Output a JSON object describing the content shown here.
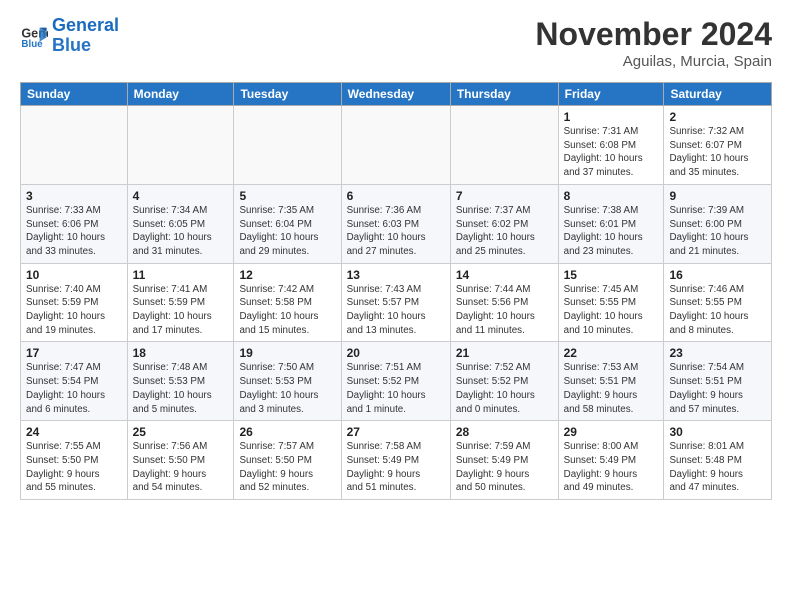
{
  "header": {
    "logo_line1": "General",
    "logo_line2": "Blue",
    "month_title": "November 2024",
    "location": "Aguilas, Murcia, Spain"
  },
  "weekdays": [
    "Sunday",
    "Monday",
    "Tuesday",
    "Wednesday",
    "Thursday",
    "Friday",
    "Saturday"
  ],
  "weeks": [
    [
      {
        "day": "",
        "info": ""
      },
      {
        "day": "",
        "info": ""
      },
      {
        "day": "",
        "info": ""
      },
      {
        "day": "",
        "info": ""
      },
      {
        "day": "",
        "info": ""
      },
      {
        "day": "1",
        "info": "Sunrise: 7:31 AM\nSunset: 6:08 PM\nDaylight: 10 hours\nand 37 minutes."
      },
      {
        "day": "2",
        "info": "Sunrise: 7:32 AM\nSunset: 6:07 PM\nDaylight: 10 hours\nand 35 minutes."
      }
    ],
    [
      {
        "day": "3",
        "info": "Sunrise: 7:33 AM\nSunset: 6:06 PM\nDaylight: 10 hours\nand 33 minutes."
      },
      {
        "day": "4",
        "info": "Sunrise: 7:34 AM\nSunset: 6:05 PM\nDaylight: 10 hours\nand 31 minutes."
      },
      {
        "day": "5",
        "info": "Sunrise: 7:35 AM\nSunset: 6:04 PM\nDaylight: 10 hours\nand 29 minutes."
      },
      {
        "day": "6",
        "info": "Sunrise: 7:36 AM\nSunset: 6:03 PM\nDaylight: 10 hours\nand 27 minutes."
      },
      {
        "day": "7",
        "info": "Sunrise: 7:37 AM\nSunset: 6:02 PM\nDaylight: 10 hours\nand 25 minutes."
      },
      {
        "day": "8",
        "info": "Sunrise: 7:38 AM\nSunset: 6:01 PM\nDaylight: 10 hours\nand 23 minutes."
      },
      {
        "day": "9",
        "info": "Sunrise: 7:39 AM\nSunset: 6:00 PM\nDaylight: 10 hours\nand 21 minutes."
      }
    ],
    [
      {
        "day": "10",
        "info": "Sunrise: 7:40 AM\nSunset: 5:59 PM\nDaylight: 10 hours\nand 19 minutes."
      },
      {
        "day": "11",
        "info": "Sunrise: 7:41 AM\nSunset: 5:59 PM\nDaylight: 10 hours\nand 17 minutes."
      },
      {
        "day": "12",
        "info": "Sunrise: 7:42 AM\nSunset: 5:58 PM\nDaylight: 10 hours\nand 15 minutes."
      },
      {
        "day": "13",
        "info": "Sunrise: 7:43 AM\nSunset: 5:57 PM\nDaylight: 10 hours\nand 13 minutes."
      },
      {
        "day": "14",
        "info": "Sunrise: 7:44 AM\nSunset: 5:56 PM\nDaylight: 10 hours\nand 11 minutes."
      },
      {
        "day": "15",
        "info": "Sunrise: 7:45 AM\nSunset: 5:55 PM\nDaylight: 10 hours\nand 10 minutes."
      },
      {
        "day": "16",
        "info": "Sunrise: 7:46 AM\nSunset: 5:55 PM\nDaylight: 10 hours\nand 8 minutes."
      }
    ],
    [
      {
        "day": "17",
        "info": "Sunrise: 7:47 AM\nSunset: 5:54 PM\nDaylight: 10 hours\nand 6 minutes."
      },
      {
        "day": "18",
        "info": "Sunrise: 7:48 AM\nSunset: 5:53 PM\nDaylight: 10 hours\nand 5 minutes."
      },
      {
        "day": "19",
        "info": "Sunrise: 7:50 AM\nSunset: 5:53 PM\nDaylight: 10 hours\nand 3 minutes."
      },
      {
        "day": "20",
        "info": "Sunrise: 7:51 AM\nSunset: 5:52 PM\nDaylight: 10 hours\nand 1 minute."
      },
      {
        "day": "21",
        "info": "Sunrise: 7:52 AM\nSunset: 5:52 PM\nDaylight: 10 hours\nand 0 minutes."
      },
      {
        "day": "22",
        "info": "Sunrise: 7:53 AM\nSunset: 5:51 PM\nDaylight: 9 hours\nand 58 minutes."
      },
      {
        "day": "23",
        "info": "Sunrise: 7:54 AM\nSunset: 5:51 PM\nDaylight: 9 hours\nand 57 minutes."
      }
    ],
    [
      {
        "day": "24",
        "info": "Sunrise: 7:55 AM\nSunset: 5:50 PM\nDaylight: 9 hours\nand 55 minutes."
      },
      {
        "day": "25",
        "info": "Sunrise: 7:56 AM\nSunset: 5:50 PM\nDaylight: 9 hours\nand 54 minutes."
      },
      {
        "day": "26",
        "info": "Sunrise: 7:57 AM\nSunset: 5:50 PM\nDaylight: 9 hours\nand 52 minutes."
      },
      {
        "day": "27",
        "info": "Sunrise: 7:58 AM\nSunset: 5:49 PM\nDaylight: 9 hours\nand 51 minutes."
      },
      {
        "day": "28",
        "info": "Sunrise: 7:59 AM\nSunset: 5:49 PM\nDaylight: 9 hours\nand 50 minutes."
      },
      {
        "day": "29",
        "info": "Sunrise: 8:00 AM\nSunset: 5:49 PM\nDaylight: 9 hours\nand 49 minutes."
      },
      {
        "day": "30",
        "info": "Sunrise: 8:01 AM\nSunset: 5:48 PM\nDaylight: 9 hours\nand 47 minutes."
      }
    ]
  ]
}
